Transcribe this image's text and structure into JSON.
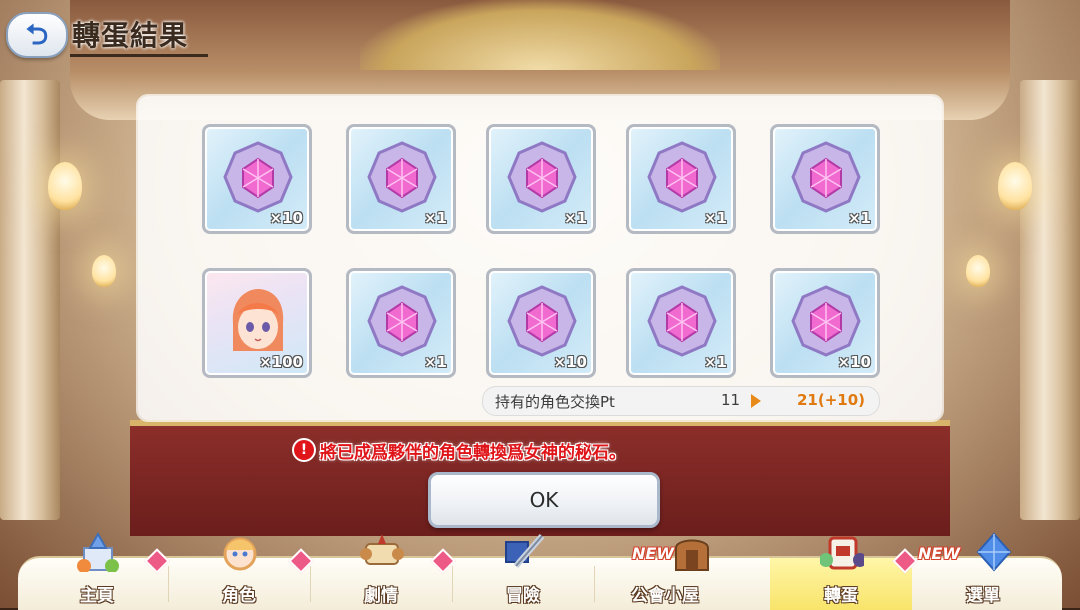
{
  "header": {
    "title": "轉蛋結果",
    "back_icon": "back-arrow-icon"
  },
  "results": {
    "row1": [
      {
        "type": "goddess-stone",
        "qty": "×10"
      },
      {
        "type": "goddess-stone",
        "qty": "×1"
      },
      {
        "type": "goddess-stone",
        "qty": "×1"
      },
      {
        "type": "goddess-stone",
        "qty": "×1"
      },
      {
        "type": "goddess-stone",
        "qty": "×1"
      }
    ],
    "row2": [
      {
        "type": "character-portrait",
        "qty": "×100"
      },
      {
        "type": "goddess-stone",
        "qty": "×1"
      },
      {
        "type": "goddess-stone",
        "qty": "×10"
      },
      {
        "type": "goddess-stone",
        "qty": "×1"
      },
      {
        "type": "goddess-stone",
        "qty": "×10"
      }
    ]
  },
  "points": {
    "label": "持有的角色交換Pt",
    "old": "11",
    "new": "21(+10)",
    "new_color": "#e07a10"
  },
  "notice": {
    "icon": "!",
    "text": "將已成爲夥伴的角色轉換爲女神的秘石。",
    "color": "#e0151a"
  },
  "ok_label": "OK",
  "nav": {
    "items": [
      {
        "label": "主頁",
        "icon": "home-castle-icon",
        "badge": "diamond"
      },
      {
        "label": "角色",
        "icon": "character-icon",
        "badge": "diamond"
      },
      {
        "label": "劇情",
        "icon": "story-scroll-icon",
        "badge": "diamond"
      },
      {
        "label": "冒險",
        "icon": "adventure-sword-icon",
        "badge": ""
      },
      {
        "label": "公會小屋",
        "icon": "guild-house-icon",
        "badge": "NEW"
      },
      {
        "label": "轉蛋",
        "icon": "gacha-icon",
        "badge": "diamond",
        "active": true
      },
      {
        "label": "選單",
        "icon": "menu-crystal-icon",
        "badge": "NEW"
      }
    ]
  }
}
